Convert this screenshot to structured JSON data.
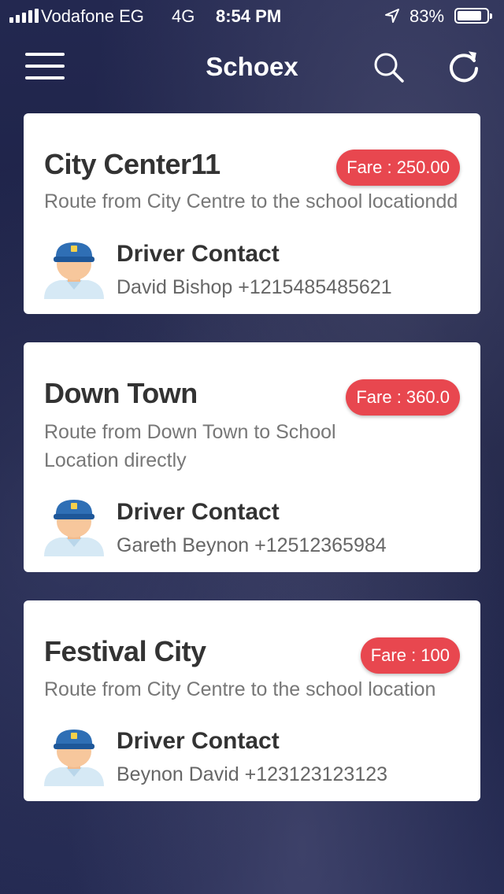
{
  "status_bar": {
    "carrier": "Vodafone EG",
    "network": "4G",
    "time": "8:54 PM",
    "battery_percent": "83%",
    "battery_level": 0.83
  },
  "header": {
    "title": "Schoex",
    "menu_icon": "hamburger-menu-icon",
    "search_icon": "search-icon",
    "refresh_icon": "refresh-icon"
  },
  "colors": {
    "fare_badge": "#e8474f",
    "card_bg": "#ffffff",
    "driver_cap": "#2f6fb5"
  },
  "routes": [
    {
      "name": "City Center11",
      "fare": "Fare : 250.00",
      "description": "Route from City Centre to the school locationdd",
      "driver_label": "Driver Contact",
      "driver": "David Bishop +1215485485621"
    },
    {
      "name": "Down Town",
      "fare": "Fare : 360.0",
      "description": "Route from Down Town to School Location directly",
      "driver_label": "Driver Contact",
      "driver": "Gareth Beynon +12512365984"
    },
    {
      "name": "Festival City",
      "fare": "Fare : 100",
      "description": "Route from City Centre to the school location",
      "driver_label": "Driver Contact",
      "driver": "Beynon David +123123123123"
    }
  ]
}
